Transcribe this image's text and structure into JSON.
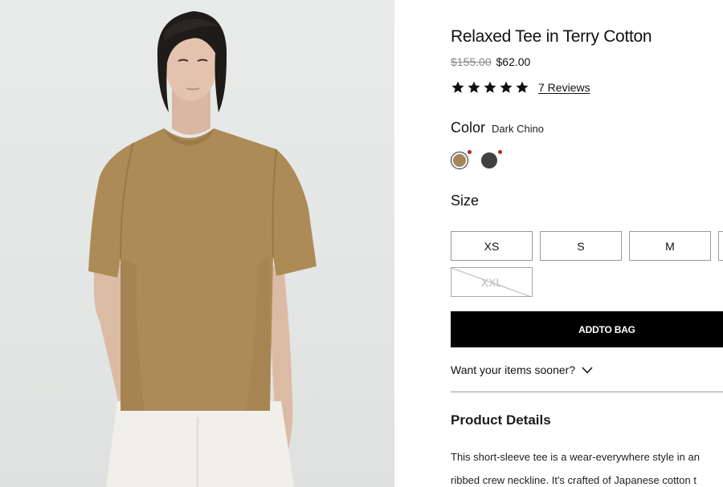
{
  "product": {
    "title": "Relaxed Tee in Terry Cotton",
    "price_original": "$155.00",
    "price_sale": "$62.00",
    "rating": {
      "stars": 5,
      "max": 5,
      "reviews_label": "7 Reviews"
    },
    "image": {
      "subject": "model wearing short-sleeve tee"
    }
  },
  "color": {
    "heading": "Color",
    "selected": "Dark Chino",
    "swatches": [
      {
        "name": "Dark Chino",
        "hex": "#a5865a",
        "selected": true
      },
      {
        "name": "",
        "hex": "#404142",
        "selected": false
      }
    ],
    "indicator_color": "#b3261e"
  },
  "size": {
    "heading": "Size",
    "options": [
      {
        "label": "XS",
        "available": true
      },
      {
        "label": "S",
        "available": true
      },
      {
        "label": "M",
        "available": true
      },
      {
        "label": "",
        "available": true
      },
      {
        "label": "XXL",
        "available": false
      }
    ]
  },
  "actions": {
    "add_to_bag": "ADDTO BAG",
    "delivery_prompt": "Want your items sooner?"
  },
  "details": {
    "heading": "Product Details",
    "lines": [
      "This short-sleeve tee is a wear-everywhere style in an",
      "ribbed crew neckline. It's crafted of Japanese cotton t"
    ]
  },
  "colors": {
    "button": "#000000",
    "text": "#111111",
    "accent": "#b3261e"
  },
  "icons": {
    "rating": "star-icon",
    "expand": "chevron-down-icon"
  }
}
